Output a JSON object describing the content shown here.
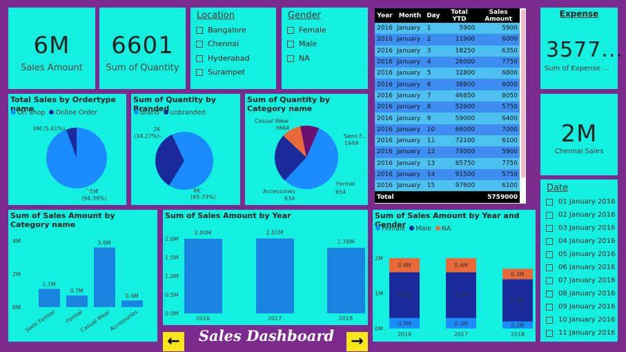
{
  "cards": {
    "sales_amount": {
      "value": "6M",
      "label": "Sales Amount"
    },
    "sum_quantity": {
      "value": "6601",
      "label": "Sum of Quantity"
    },
    "expense": {
      "title": "Expense",
      "value": "3577...",
      "label": "Sum of Expense ..."
    },
    "chennai": {
      "value": "2M",
      "label": "Chennai Sales"
    }
  },
  "location_slicer": {
    "title": "Location",
    "options": [
      "Bangalore",
      "Chennai",
      "Hyderabad",
      "Surampet"
    ]
  },
  "gender_slicer": {
    "title": "Gender",
    "options": [
      "Female",
      "Male",
      "NA"
    ]
  },
  "sales_table": {
    "headers": [
      "Year",
      "Month",
      "Day",
      "Total YTD",
      "Sales Amount"
    ],
    "rows": [
      [
        "2016",
        "January",
        "1",
        "5900",
        "5900"
      ],
      [
        "2016",
        "January",
        "2",
        "11900",
        "6000"
      ],
      [
        "2016",
        "January",
        "3",
        "18250",
        "6350"
      ],
      [
        "2016",
        "January",
        "4",
        "26000",
        "7750"
      ],
      [
        "2016",
        "January",
        "5",
        "32800",
        "6800"
      ],
      [
        "2016",
        "January",
        "6",
        "38800",
        "6000"
      ],
      [
        "2016",
        "January",
        "7",
        "46850",
        "8050"
      ],
      [
        "2016",
        "January",
        "8",
        "52600",
        "5750"
      ],
      [
        "2016",
        "January",
        "9",
        "59000",
        "6400"
      ],
      [
        "2016",
        "January",
        "10",
        "66000",
        "7000"
      ],
      [
        "2016",
        "January",
        "11",
        "72100",
        "6100"
      ],
      [
        "2016",
        "January",
        "12",
        "78000",
        "5900"
      ],
      [
        "2016",
        "January",
        "13",
        "85750",
        "7750"
      ],
      [
        "2016",
        "January",
        "14",
        "91500",
        "5750"
      ],
      [
        "2016",
        "January",
        "15",
        "97600",
        "6100"
      ]
    ],
    "total_label": "Total",
    "total_value": "5759000"
  },
  "date_slicer": {
    "title": "Date",
    "dates": [
      "01 January 2016",
      "02 January 2016",
      "03 January 2016",
      "04 January 2016",
      "05 January 2016",
      "06 January 2016",
      "07 January 2016",
      "08 January 2016",
      "09 January 2016",
      "10 January 2016",
      "11 January 2016"
    ]
  },
  "dashboard_title": "Sales Dashboard",
  "nav": {
    "prev": "←",
    "next": "→"
  },
  "colors": {
    "light_blue": "#1a8cff",
    "dark_blue": "#1a2a9a",
    "orange": "#e8693a",
    "purple": "#6a1070",
    "bar_blue": "#1a85e0"
  },
  "chart_data": [
    {
      "id": "ordertype",
      "type": "pie",
      "title": "Total Sales by Ordertype name",
      "legend": [
        "On Shop",
        "Online Order"
      ],
      "slices": [
        {
          "name": "On Shop",
          "value": 94.39,
          "label": "5M",
          "pct": "(94.39%)"
        },
        {
          "name": "Online Order",
          "value": 5.61,
          "label": "0M (5.61%)"
        }
      ]
    },
    {
      "id": "branded",
      "type": "pie",
      "title": "Sum of Quantity by Branded",
      "legend": [
        "brand",
        "unbranded"
      ],
      "slices": [
        {
          "name": "brand",
          "value": 65.73,
          "label": "4K",
          "pct": "(65.73%)"
        },
        {
          "name": "unbranded",
          "value": 34.27,
          "label": "2K",
          "pct": "(34.27%)"
        }
      ]
    },
    {
      "id": "category_qty",
      "type": "pie",
      "title": "Sum of Quantity by Category name",
      "slices": [
        {
          "name": "Casual Wear",
          "value": 3664
        },
        {
          "name": "Semi F...",
          "value": 1649
        },
        {
          "name": "Formal",
          "value": 654
        },
        {
          "name": "Accessories",
          "value": 634
        }
      ]
    },
    {
      "id": "category_sales",
      "type": "bar",
      "title": "Sum of Sales Amount by Category name",
      "categories": [
        "Semi Formal",
        "Formal",
        "Casual Wear",
        "Accessories"
      ],
      "values": [
        1.1,
        0.7,
        3.6,
        0.4
      ],
      "data_labels": [
        "1.1M",
        "0.7M",
        "3.6M",
        "0.4M"
      ],
      "yticks": [
        "0M",
        "2M",
        "4M"
      ],
      "ylim": [
        0,
        4
      ]
    },
    {
      "id": "year_sales",
      "type": "bar",
      "title": "Sum of Sales Amount by Year",
      "categories": [
        "2016",
        "2017",
        "2018"
      ],
      "values": [
        2.0,
        2.01,
        1.76
      ],
      "data_labels": [
        "2.00M",
        "2.01M",
        "1.76M"
      ],
      "yticks": [
        "0.0M",
        "0.5M",
        "1.0M",
        "1.5M",
        "2.0M"
      ],
      "ylim": [
        0,
        2.0
      ]
    },
    {
      "id": "year_gender",
      "type": "bar",
      "stacked": true,
      "title": "Sum of Sales Amount by Year and Gender",
      "categories": [
        "2016",
        "2017",
        "2018"
      ],
      "series": [
        {
          "name": "Female",
          "values": [
            0.3,
            0.3,
            0.2
          ],
          "labels": [
            "0.3M",
            "0.3M",
            "0.2M"
          ]
        },
        {
          "name": "Male",
          "values": [
            1.3,
            1.3,
            1.2
          ],
          "labels": [
            "1.3M",
            "1.3M",
            "1.2M"
          ]
        },
        {
          "name": "NA",
          "values": [
            0.4,
            0.4,
            0.3
          ],
          "labels": [
            "0.4M",
            "0.4M",
            "0.3M"
          ]
        }
      ],
      "yticks": [
        "0M",
        "1M",
        "2M"
      ],
      "ylim": [
        0,
        2
      ]
    }
  ]
}
